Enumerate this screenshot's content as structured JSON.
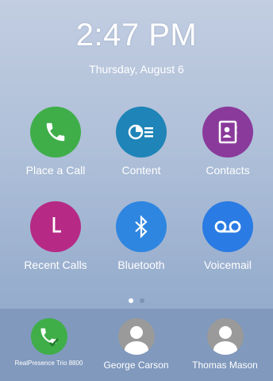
{
  "clock": {
    "time": "2:47 PM",
    "date": "Thursday, August 6"
  },
  "apps": [
    {
      "label": "Place a Call",
      "icon": "phone-icon",
      "color": "#3fae49"
    },
    {
      "label": "Content",
      "icon": "content-icon",
      "color": "#1f84b8"
    },
    {
      "label": "Contacts",
      "icon": "contacts-icon",
      "color": "#8a3a9b"
    },
    {
      "label": "Recent Calls",
      "icon": "clock-icon",
      "color": "#b62a86"
    },
    {
      "label": "Bluetooth",
      "icon": "bluetooth-icon",
      "color": "#2e86e0"
    },
    {
      "label": "Voicemail",
      "icon": "voicemail-icon",
      "color": "#2a7be3"
    }
  ],
  "pager": {
    "pages": 2,
    "active": 1
  },
  "dock": [
    {
      "label": "RealPresence Trio 8800",
      "icon": "phone-check-icon",
      "color": "#3fae49"
    },
    {
      "label": "George Carson",
      "icon": "person-icon",
      "color": "#9a9a9a"
    },
    {
      "label": "Thomas Mason",
      "icon": "person-icon",
      "color": "#9a9a9a"
    }
  ]
}
